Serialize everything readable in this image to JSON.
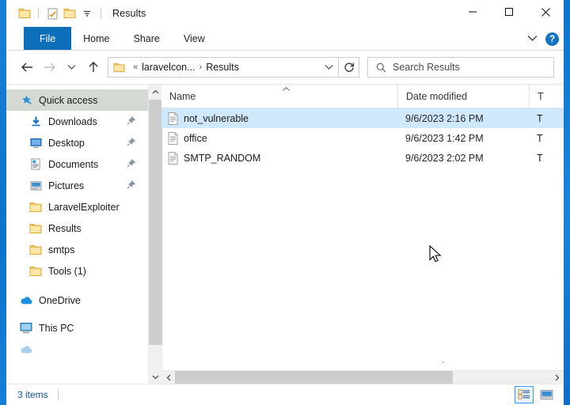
{
  "window": {
    "title": "Results",
    "quick_access_toolbar": [
      {
        "name": "folder-icon",
        "label": "Folder"
      },
      {
        "name": "properties-icon",
        "label": "Properties"
      },
      {
        "name": "new-folder-icon",
        "label": "New folder"
      },
      {
        "name": "customize-chevron-icon",
        "label": "Customize Quick Access Toolbar"
      }
    ],
    "controls": {
      "minimize": "—",
      "maximize": "□",
      "close": "✕"
    }
  },
  "ribbon": {
    "tabs": [
      {
        "label": "File",
        "active": true
      },
      {
        "label": "Home",
        "active": false
      },
      {
        "label": "Share",
        "active": false
      },
      {
        "label": "View",
        "active": false
      }
    ],
    "expand_icon": "chevron-down-icon",
    "help_label": "?"
  },
  "navigation": {
    "back_icon": "arrow-left-icon",
    "forward_icon": "arrow-right-icon",
    "recent_icon": "chevron-down-icon",
    "up_icon": "arrow-up-icon",
    "breadcrumb": {
      "overflow": "«",
      "parts": [
        "laravelcon...",
        "Results"
      ],
      "separator": "›"
    },
    "dropdown_icon": "chevron-down-icon",
    "refresh_icon": "refresh-icon"
  },
  "search": {
    "placeholder": "Search Results",
    "icon": "search-icon"
  },
  "sidebar": {
    "items": [
      {
        "label": "Quick access",
        "icon": "star-pin-icon",
        "selected": true,
        "pinned": false,
        "indent": 0
      },
      {
        "label": "Downloads",
        "icon": "downloads-icon",
        "selected": false,
        "pinned": true,
        "indent": 1
      },
      {
        "label": "Desktop",
        "icon": "desktop-icon",
        "selected": false,
        "pinned": true,
        "indent": 1
      },
      {
        "label": "Documents",
        "icon": "documents-icon",
        "selected": false,
        "pinned": true,
        "indent": 1
      },
      {
        "label": "Pictures",
        "icon": "pictures-icon",
        "selected": false,
        "pinned": true,
        "indent": 1
      },
      {
        "label": "LaravelExploiter",
        "icon": "folder-icon",
        "selected": false,
        "pinned": false,
        "indent": 1
      },
      {
        "label": "Results",
        "icon": "folder-icon",
        "selected": false,
        "pinned": false,
        "indent": 1
      },
      {
        "label": "smtps",
        "icon": "folder-icon",
        "selected": false,
        "pinned": false,
        "indent": 1
      },
      {
        "label": "Tools (1)",
        "icon": "folder-icon",
        "selected": false,
        "pinned": false,
        "indent": 1
      },
      {
        "label": "OneDrive",
        "icon": "onedrive-cloud-icon",
        "selected": false,
        "pinned": false,
        "indent": 0
      },
      {
        "label": "This PC",
        "icon": "this-pc-icon",
        "selected": false,
        "pinned": false,
        "indent": 0
      }
    ]
  },
  "filelist": {
    "columns": [
      {
        "label": "Name",
        "sorted": "ascending"
      },
      {
        "label": "Date modified",
        "sorted": ""
      },
      {
        "label": "T",
        "sorted": ""
      }
    ],
    "sort_indicator": "˄",
    "rows": [
      {
        "name": "not_vulnerable",
        "date_modified": "9/6/2023 2:16 PM",
        "type": "T",
        "icon": "text-document-icon",
        "selected": true
      },
      {
        "name": "office",
        "date_modified": "9/6/2023 1:42 PM",
        "type": "T",
        "icon": "text-document-icon",
        "selected": false
      },
      {
        "name": "SMTP_RANDOM",
        "date_modified": "9/6/2023 2:02 PM",
        "type": "T",
        "icon": "text-document-icon",
        "selected": false
      }
    ]
  },
  "statusbar": {
    "item_count": "3 items",
    "view_buttons": [
      {
        "name": "details-view-button",
        "active": true
      },
      {
        "name": "large-icons-view-button",
        "active": false
      }
    ]
  },
  "colors": {
    "accent": "#0d6fba",
    "selection": "#cfe8fc",
    "nav_selection": "#d4dad2",
    "status_text": "#15539e",
    "desktop": "#0e76cd"
  }
}
